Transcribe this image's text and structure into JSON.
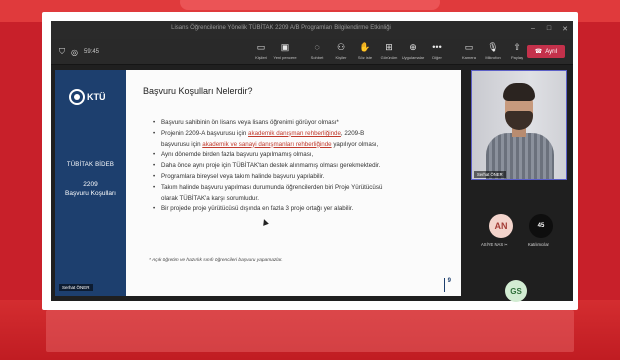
{
  "window": {
    "title": "Lisans Öğrencilerine Yönelik TÜBİTAK 2209 A/B Programları Bilgilendirme Etkinliği",
    "controls": [
      "–",
      "□",
      "✕"
    ]
  },
  "toolbar": {
    "left_icons": [
      "shield-icon",
      "grid-icon"
    ],
    "elapsed": "59:45",
    "buttons": [
      {
        "name": "notes",
        "icon": "▭",
        "label": "Kişileri"
      },
      {
        "name": "new-presenter",
        "icon": "▣",
        "label": "Yeni pencere"
      },
      {
        "name": "chat",
        "icon": "◌",
        "label": "Sohbet"
      },
      {
        "name": "people",
        "icon": "⚇",
        "label": "Kişiler"
      },
      {
        "name": "raise-hand",
        "icon": "✋",
        "label": "Söz iste"
      },
      {
        "name": "view",
        "icon": "⊞",
        "label": "Görünüm"
      },
      {
        "name": "apps",
        "icon": "⊕",
        "label": "Uygulamalar"
      },
      {
        "name": "more",
        "icon": "•••",
        "label": "Diğer"
      },
      {
        "name": "camera",
        "icon": "▭",
        "label": "Kamera"
      },
      {
        "name": "mic",
        "icon": "🎙",
        "label": "Mikrofon"
      },
      {
        "name": "share",
        "icon": "⇧",
        "label": "Paylaş"
      }
    ],
    "leave_icon": "☎",
    "leave_label": "Ayrıl"
  },
  "slide": {
    "logo_text": "KTÜ",
    "side_line1": "TÜBİTAK BİDEB",
    "side_line2a": "2209",
    "side_line2b": "Başvuru Koşulları",
    "presenter_label": "Serhat ÖNER",
    "title": "Başvuru Koşulları Nelerdir?",
    "bullets": [
      {
        "text": "Başvuru sahibinin ön lisans veya lisans öğrenimi görüyor olması*"
      },
      {
        "pre": "Projenin 2209-A başvurusu için ",
        "red": "akademik danışman rehberliğinde",
        "post": ", 2209-B"
      },
      {
        "pre": "başvurusu için ",
        "red": "akademik ve sanayi danışmanları rehberliğinde",
        "post": " yapılıyor olması,",
        "continuation": true
      },
      {
        "text": "Aynı dönemde birden fazla başvuru yapılmamış olması,"
      },
      {
        "text": "Daha önce aynı proje için TÜBİTAK'tan destek alınmamış olması gerekmektedir."
      },
      {
        "text": "Programlara bireysel veya takım halinde başvuru yapılabilir."
      },
      {
        "text": "Takım halinde başvuru yapılması durumunda öğrencilerden biri Proje Yürütücüsü"
      },
      {
        "text": "olarak TÜBİTAK'a karşı sorumludur.",
        "continuation": true
      },
      {
        "text": "Bir projede proje yürütücüsü dışında en fazla 3 proje ortağı yer alabilir."
      }
    ],
    "footnote": "* Açık öğretim ve hazırlık sınıfı öğrencileri başvuru yapamazlar.",
    "page_number": "9"
  },
  "participants": {
    "video_name": "Serhat ÖNER",
    "people": [
      {
        "initials": "AN",
        "label": "ASİYE NAS",
        "status_icon": "mic-off-icon",
        "status_glyph": "✂"
      },
      {
        "initials": "45",
        "label": "Katılımcılar"
      },
      {
        "initials": "GS",
        "label": ""
      }
    ]
  },
  "colors": {
    "background": "#c8202a",
    "slide_sidebar": "#1d3f6e",
    "leave_button": "#c4314b",
    "link_red": "#c0392b",
    "active_speaker_border": "#5b5fc7"
  }
}
